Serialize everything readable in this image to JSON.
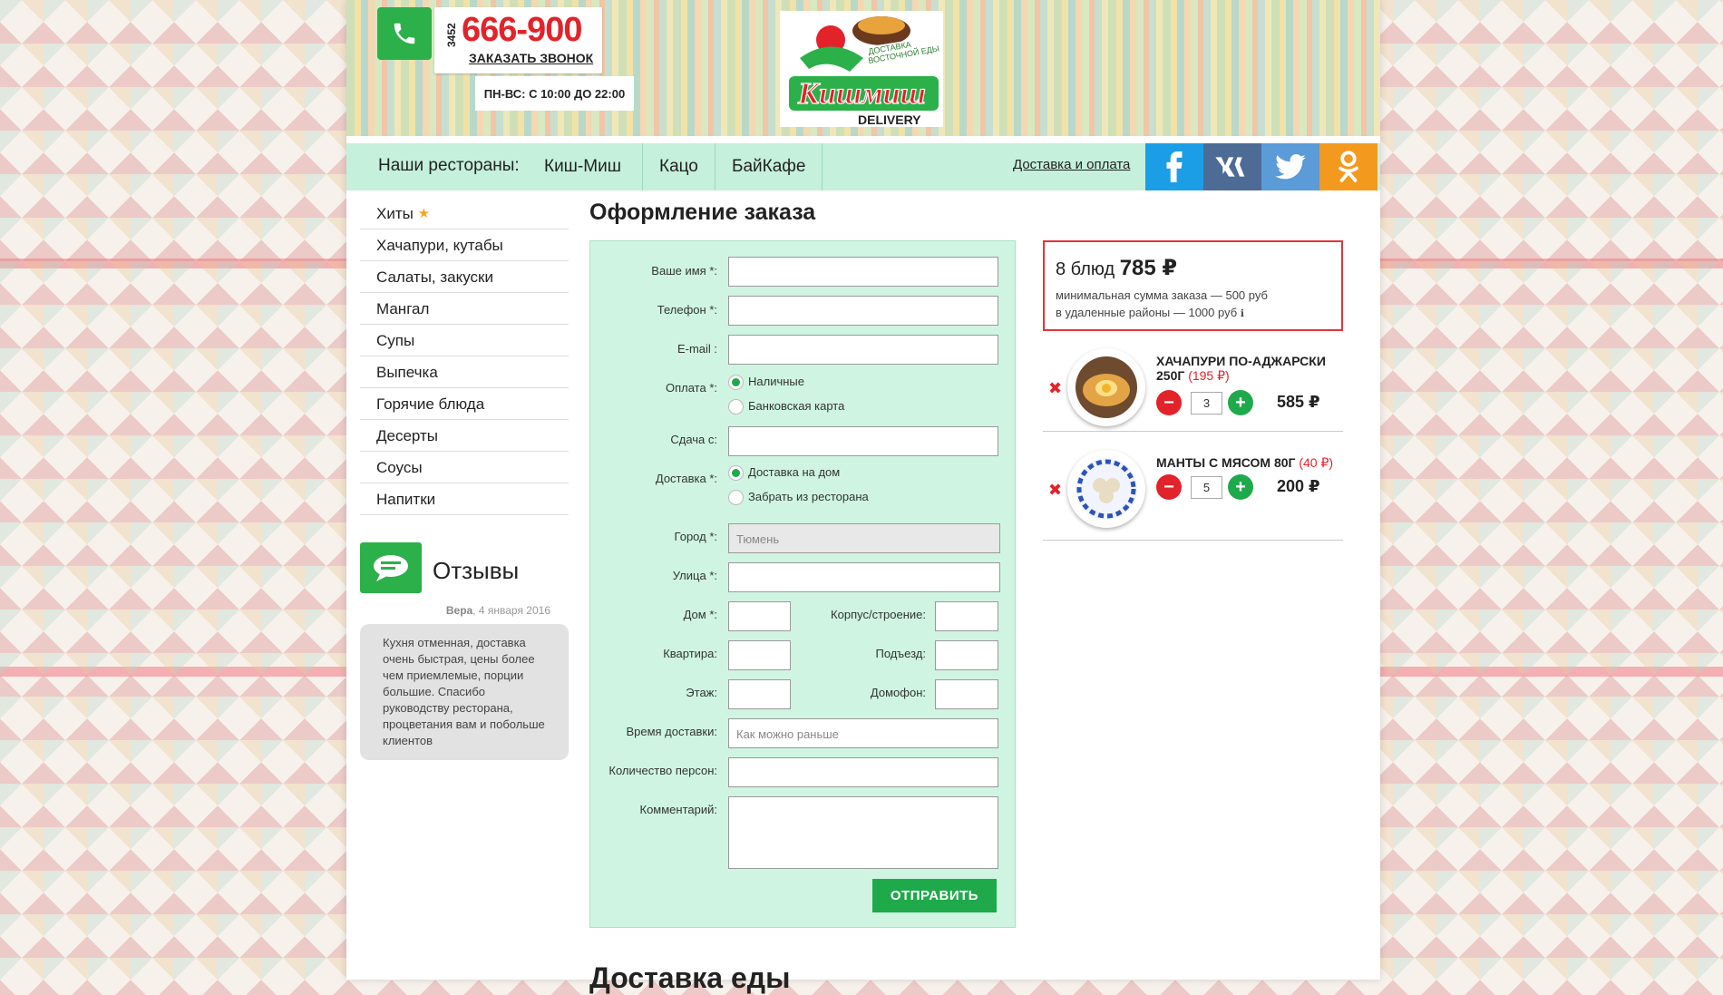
{
  "header": {
    "phone_code": "3452",
    "phone_number": "666-900",
    "call_label": "ЗАКАЗАТЬ ЗВОНОК",
    "hours": "ПН-ВС: С 10:00 ДО 22:00",
    "logo_text": "Кишмиш",
    "logo_sub": "DELIVERY",
    "logo_tagline": "ДОСТАВКА ВОСТОЧНОЙ ЕДЫ"
  },
  "nav": {
    "label": "Наши рестораны:",
    "restaurants": [
      "Киш-Миш",
      "Кацо",
      "БайКафе"
    ],
    "delivery_link": "Доставка и оплата",
    "social": [
      "facebook-icon",
      "vk-icon",
      "twitter-icon",
      "odnoklassniki-icon"
    ],
    "social_colors": [
      "#1c9ee6",
      "#4c6c96",
      "#5a9bd8",
      "#f39a1e"
    ]
  },
  "sidebar": {
    "menu": [
      "Хиты",
      "Хачапури, кутабы",
      "Салаты, закуски",
      "Мангал",
      "Супы",
      "Выпечка",
      "Горячие блюда",
      "Десерты",
      "Соусы",
      "Напитки"
    ]
  },
  "reviews": {
    "title": "Отзывы",
    "author": "Вера",
    "date": ", 4 января 2016",
    "text": "Кухня отменная, доставка очень быстрая, цены более чем приемлемые, порции большие. Спасибо руководству ресторана, процветания вам и побольше клиентов"
  },
  "order": {
    "title": "Оформление заказа",
    "labels": {
      "name": "Ваше имя *:",
      "phone": "Телефон *:",
      "email": "E-mail :",
      "payment": "Оплата *:",
      "change": "Сдача с:",
      "delivery": "Доставка *:",
      "city": "Город *:",
      "street": "Улица *:",
      "house": "Дом *:",
      "building": "Корпус/строение:",
      "apartment": "Квартира:",
      "entrance": "Подъезд:",
      "floor": "Этаж:",
      "intercom": "Домофон:",
      "time": "Время доставки:",
      "persons": "Количество персон:",
      "comment": "Комментарий:"
    },
    "payment_options": [
      "Наличные",
      "Банковская карта"
    ],
    "delivery_options": [
      "Доставка на дом",
      "Забрать из ресторана"
    ],
    "city_value": "Тюмень",
    "time_placeholder": "Как можно раньше",
    "submit": "ОТПРАВИТЬ",
    "below_heading": "Доставка еды"
  },
  "cart": {
    "count_text": "8 блюд",
    "total": "785 ₽",
    "min_order": "минимальная сумма заказа — 500 руб",
    "remote": "в удаленные районы — 1000 руб",
    "items": [
      {
        "name": "ХАЧАПУРИ ПО-АДЖАРСКИ 250Г",
        "unit_price": "(195 ₽)",
        "qty": "3",
        "price": "585 ₽"
      },
      {
        "name": "МАНТЫ С МЯСОМ 80Г",
        "unit_price": "(40 ₽)",
        "qty": "5",
        "price": "200 ₽"
      }
    ]
  }
}
